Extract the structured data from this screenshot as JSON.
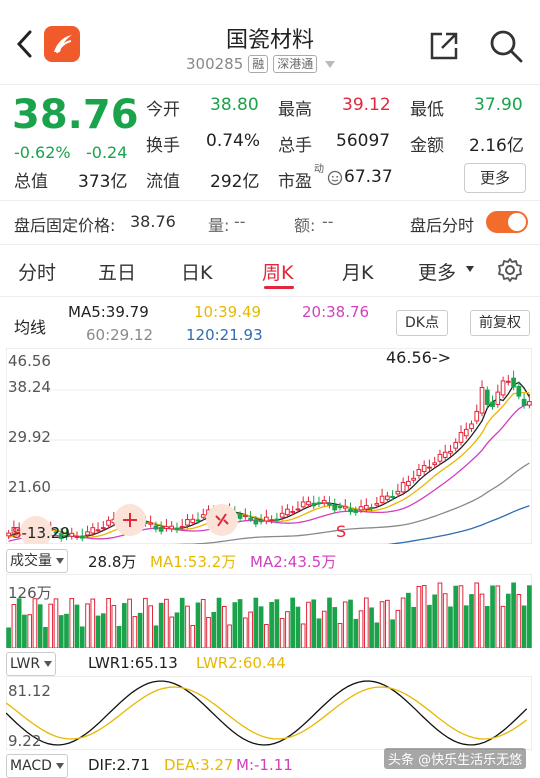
{
  "header": {
    "title": "国瓷材料",
    "code": "300285",
    "tag1": "融",
    "tag2": "深港通"
  },
  "quote": {
    "price": "38.76",
    "chg_pct": "-0.62%",
    "chg_abs": "-0.24",
    "rows": [
      [
        {
          "label": "今开",
          "value": "38.80",
          "color": "green"
        },
        {
          "label": "最高",
          "value": "39.12",
          "color": "red"
        },
        {
          "label": "最低",
          "value": "37.90",
          "color": "green"
        }
      ],
      [
        {
          "label": "换手",
          "value": "0.74%"
        },
        {
          "label": "总手",
          "value": "56097"
        },
        {
          "label": "金额",
          "value": "2.16亿"
        }
      ]
    ],
    "mv_label": "总值",
    "mv_value": "373亿",
    "float_label": "流值",
    "float_value": "292亿",
    "pe_label": "市盈",
    "pe_sup": "动",
    "pe_value": "67.37",
    "more": "更多"
  },
  "after_hours": {
    "label": "盘后固定价格:",
    "price": "38.76",
    "vol_label": "量:",
    "vol": "--",
    "amt_label": "额:",
    "amt": "--",
    "toggle_label": "盘后分时"
  },
  "tabs": [
    "分时",
    "五日",
    "日K",
    "周K",
    "月K",
    "更多"
  ],
  "active_tab": "周K",
  "ma": {
    "label": "均线",
    "ma5": "MA5:39.79",
    "ma10": "10:39.49",
    "ma20": "20:38.76",
    "ma60": "60:29.12",
    "ma120": "120:21.93",
    "btn_dk": "DK点",
    "btn_adj": "前复权"
  },
  "main_chart": {
    "y_labels": [
      "46.56",
      "38.24",
      "29.92",
      "21.60"
    ],
    "annot_high": "46.56->",
    "annot_low": "13.29",
    "s_label": "S"
  },
  "volume": {
    "selector": "成交量",
    "vol": "28.8万",
    "ma1": "MA1:53.2万",
    "ma2": "MA2:43.5万",
    "ylabel": "126万"
  },
  "lwr": {
    "selector": "LWR",
    "lwr1": "LWR1:65.13",
    "lwr2": "LWR2:60.44",
    "y_top": "81.12",
    "y_bot": "9.22"
  },
  "macd": {
    "selector": "MACD",
    "dif": "DIF:2.71",
    "dea": "DEA:3.27",
    "m": "M:-1.11"
  },
  "watermark": "头条 @快乐生活乐无悠",
  "chart_data": {
    "type": "candlestick",
    "price_axis": [
      46.56,
      38.24,
      29.92,
      21.6
    ],
    "high_marker": 46.56,
    "low_marker": 13.29,
    "ma_last": {
      "MA5": 39.79,
      "MA10": 39.49,
      "MA20": 38.76,
      "MA60": 29.12,
      "MA120": 21.93
    },
    "colors": {
      "up": "#e2263b",
      "down": "#1aa34a",
      "ma5": "#222222",
      "ma10": "#e8b800",
      "ma20": "#d23fbf",
      "ma60": "#8a8a8a",
      "ma120": "#2f6db5"
    }
  }
}
